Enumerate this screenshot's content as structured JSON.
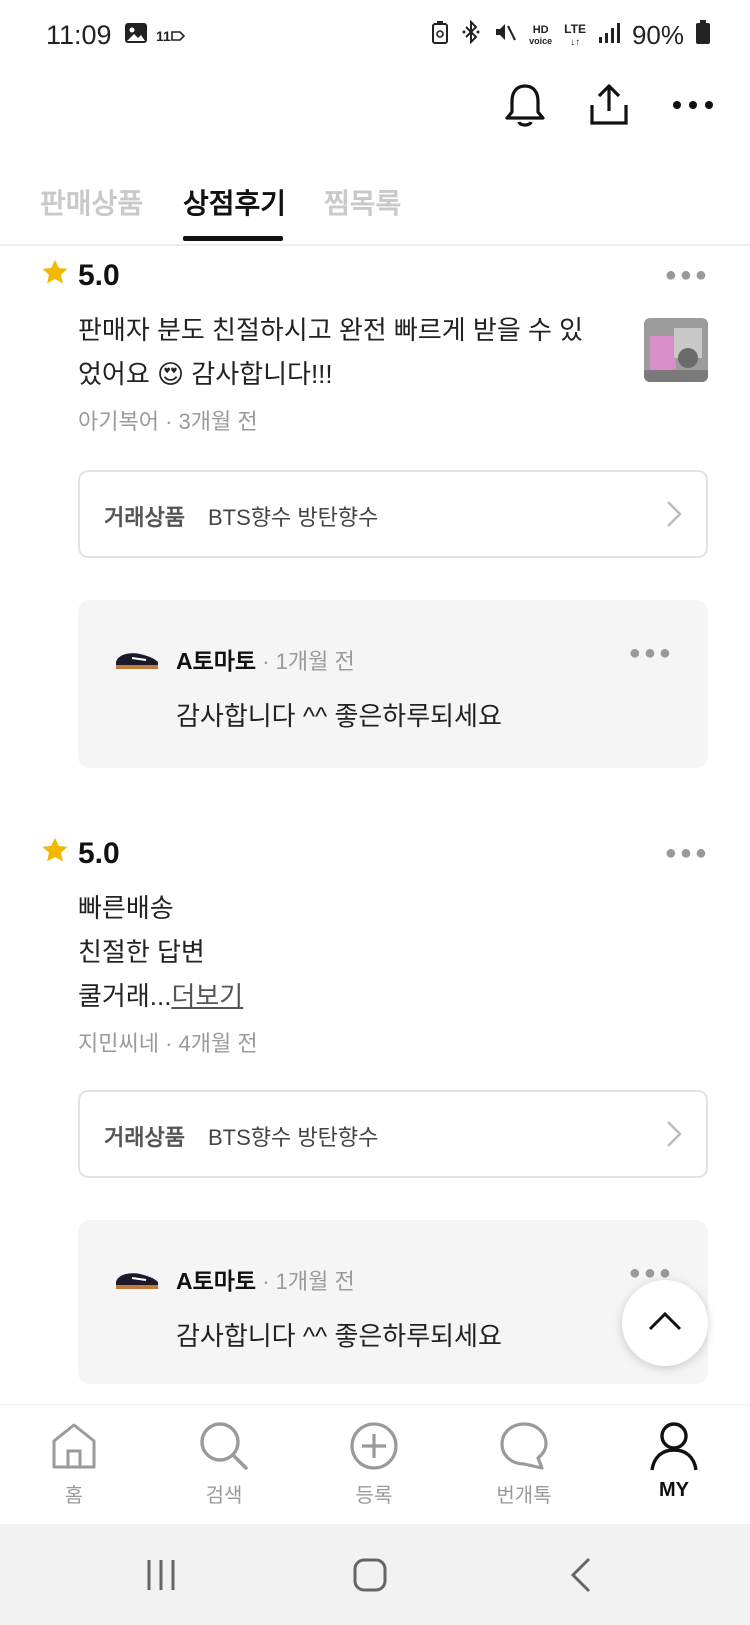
{
  "status_bar": {
    "time": "11:09",
    "carrier_badge": "11",
    "hd_voice": "HD",
    "hd_voice_sub": "voice",
    "lte": "LTE",
    "battery_percent": "90%"
  },
  "header": {
    "icons": [
      "bell-icon",
      "share-icon",
      "more-icon"
    ]
  },
  "tabs": [
    {
      "label": "판매상품",
      "active": false
    },
    {
      "label": "상점후기",
      "active": true
    },
    {
      "label": "찜목록",
      "active": false
    }
  ],
  "reviews": [
    {
      "rating": "5.0",
      "text_line1": "판매자 분도 친절하시고 완전 빠르게 받을 수 있",
      "text_line2": "었어요",
      "text_line2_end": "감사합니다!!!",
      "emoji": "😍",
      "meta": "아기복어 · 3개월 전",
      "product_label": "거래상품",
      "product_name": "BTS향수 방탄향수",
      "reply": {
        "author": "A토마토",
        "time": " · 1개월 전",
        "text": "감사합니다 ^^ 좋은하루되세요"
      }
    },
    {
      "rating": "5.0",
      "text_line1": "빠른배송",
      "text_line2": "친절한 답변",
      "text_line3": "쿨거래...",
      "more_label": "더보기",
      "meta": "지민씨네 · 4개월 전",
      "product_label": "거래상품",
      "product_name": "BTS향수 방탄향수",
      "reply": {
        "author": "A토마토",
        "time": " · 1개월 전",
        "text": "감사합니다 ^^ 좋은하루되세요"
      }
    }
  ],
  "bottom_nav": [
    {
      "label": "홈",
      "icon": "home-icon",
      "active": false
    },
    {
      "label": "검색",
      "icon": "search-icon",
      "active": false
    },
    {
      "label": "등록",
      "icon": "add-circle-icon",
      "active": false
    },
    {
      "label": "번개톡",
      "icon": "chat-icon",
      "active": false
    },
    {
      "label": "MY",
      "icon": "person-icon",
      "active": true
    }
  ],
  "colors": {
    "star": "#F5B800",
    "active_text": "#111111",
    "inactive_text": "#C9C9C9"
  }
}
